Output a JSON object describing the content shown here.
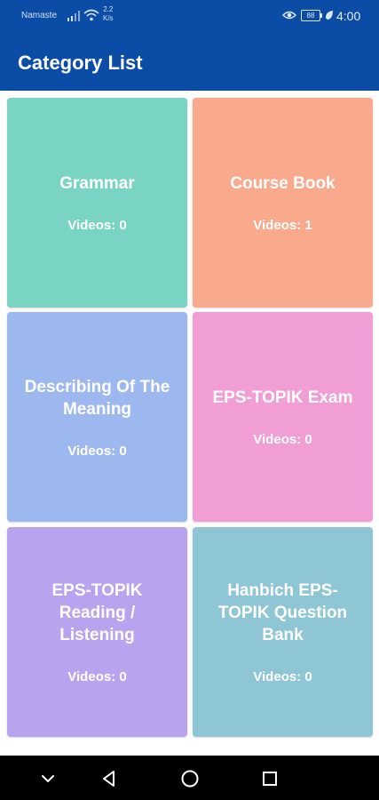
{
  "status_bar": {
    "carrier": "Namaste",
    "speed_value": "2.2",
    "speed_unit": "K/s",
    "battery": "88",
    "time": "4:00"
  },
  "app_bar": {
    "title": "Category List"
  },
  "categories": [
    {
      "title": "Grammar",
      "videos": "Videos: 0",
      "color": "#7ad4c3"
    },
    {
      "title": "Course Book",
      "videos": "Videos: 1",
      "color": "#f9a98c"
    },
    {
      "title": "Describing Of The Meaning",
      "videos": "Videos: 0",
      "color": "#9db8ee"
    },
    {
      "title": "EPS-TOPIK Exam",
      "videos": "Videos: 0",
      "color": "#f09ed4"
    },
    {
      "title": "EPS-TOPIK Reading / Listening",
      "videos": "Videos: 0",
      "color": "#b9a2ee"
    },
    {
      "title": "Hanbich EPS-TOPIK Question Bank",
      "videos": "Videos: 0",
      "color": "#8ec6d6"
    }
  ],
  "nav_bar": {
    "icons": [
      "chevron-down-icon",
      "back-icon",
      "home-icon",
      "recents-icon"
    ]
  },
  "colors": {
    "app_bar": "#0b4da6",
    "nav_bar": "#000000"
  }
}
